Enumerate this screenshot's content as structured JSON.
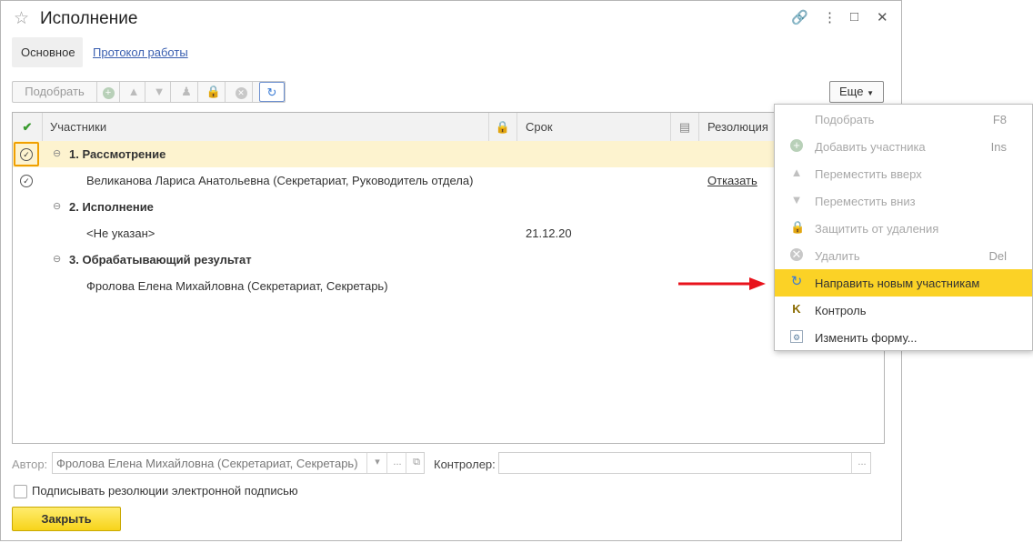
{
  "window": {
    "title": "Исполнение"
  },
  "tabs": [
    {
      "label": "Основное"
    },
    {
      "label": "Протокол работы"
    }
  ],
  "toolbar": {
    "pick_label": "Подобрать",
    "more_label": "Еще"
  },
  "grid": {
    "headers": {
      "participants": "Участники",
      "term": "Срок",
      "resolution": "Резолюция"
    },
    "rows": {
      "g1": "1. Рассмотрение",
      "r1": "Великанова Лариса Анатольевна (Секретариат, Руководитель отдела)",
      "r1_resolution": "Отказать",
      "g2": "2. Исполнение",
      "r2": "<Не указан>",
      "r2_term": "21.12.20",
      "g3": "3. Обрабатывающий результат",
      "r3": "Фролова Елена Михайловна (Секретариат, Секретарь)"
    }
  },
  "menu": {
    "items": [
      {
        "label": "Подобрать",
        "shortcut": "F8"
      },
      {
        "label": "Добавить участника",
        "shortcut": "Ins"
      },
      {
        "label": "Переместить вверх"
      },
      {
        "label": "Переместить вниз"
      },
      {
        "label": "Защитить от удаления"
      },
      {
        "label": "Удалить",
        "shortcut": "Del"
      },
      {
        "label": "Направить новым участникам"
      },
      {
        "label": "Контроль"
      },
      {
        "label": "Изменить форму..."
      }
    ]
  },
  "form": {
    "author_label": "Автор:",
    "author_value": "Фролова Елена Михайловна (Секретариат, Секретарь)",
    "controller_label": "Контролер:",
    "controller_value": "",
    "sign_label": "Подписывать резолюции электронной подписью",
    "close_label": "Закрыть"
  },
  "colors": {
    "highlight": "#fbd226",
    "arrow": "#e8121b",
    "selected_row": "#fdf3cf"
  }
}
